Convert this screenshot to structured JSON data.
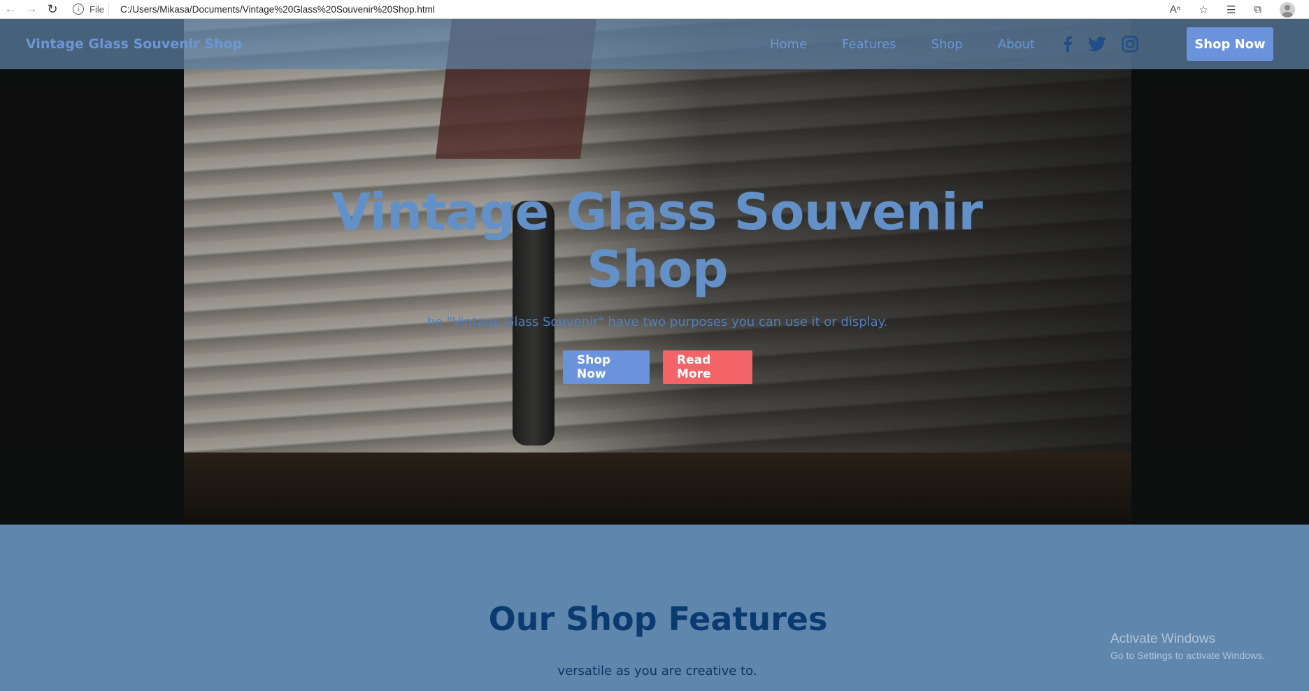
{
  "browser": {
    "file_label": "File",
    "url": "C:/Users/Mikasa/Documents/Vintage%20Glass%20Souvenir%20Shop.html"
  },
  "navbar": {
    "brand": "Vintage Glass Souvenir Shop",
    "links": [
      "Home",
      "Features",
      "Shop",
      "About"
    ],
    "socials": [
      "facebook-icon",
      "twitter-icon",
      "instagram-icon"
    ],
    "cta": "Shop Now"
  },
  "hero": {
    "title_line1": "Vintage Glass Souvenir",
    "title_line2": "Shop",
    "subtitle": "he \"Vintage Glass Souvenir\" have two purposes you can use it or display.",
    "primary_btn": "Shop Now",
    "secondary_btn": "Read More"
  },
  "features": {
    "title": "Our Shop Features",
    "subtitle": "versatile as you are creative to."
  },
  "watermark": {
    "title": "Activate Windows",
    "subtitle": "Go to Settings to activate Windows."
  },
  "colors": {
    "accent": "#6a93dc",
    "secondary": "#f26467",
    "section_bg": "#5f86ad",
    "heading": "#0b3a70"
  }
}
